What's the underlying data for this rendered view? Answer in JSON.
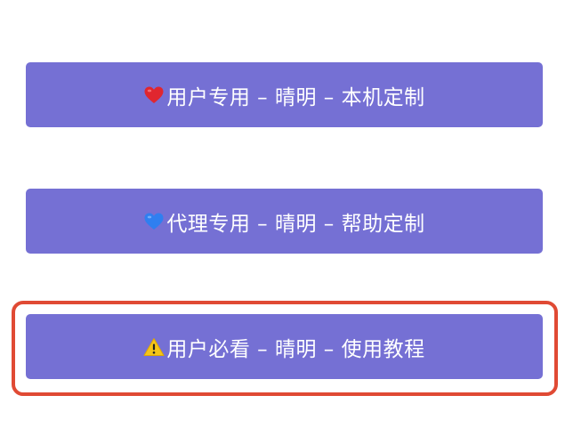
{
  "menu": {
    "items": [
      {
        "icon": "red-heart-icon",
        "label": "用户专用 – 晴明 – 本机定制"
      },
      {
        "icon": "blue-heart-icon",
        "label": "代理专用 – 晴明 – 帮助定制"
      },
      {
        "icon": "warning-icon",
        "label": "用户必看 – 晴明 – 使用教程"
      }
    ],
    "button_color": "#7570d4",
    "highlight_color": "#e04a34"
  }
}
